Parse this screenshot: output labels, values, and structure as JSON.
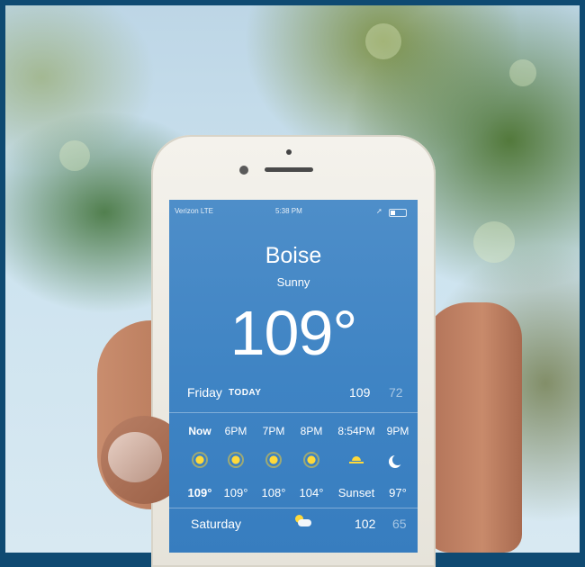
{
  "status_bar": {
    "carrier": "Verizon  LTE",
    "time": "5:38 PM"
  },
  "weather": {
    "city": "Boise",
    "condition": "Sunny",
    "current_temp": "109°",
    "today": {
      "day": "Friday",
      "tag": "TODAY",
      "high": "109",
      "low": "72"
    },
    "hourly": [
      {
        "label": "Now",
        "icon": "sun-icon",
        "temp": "109°"
      },
      {
        "label": "6PM",
        "icon": "sun-icon",
        "temp": "109°"
      },
      {
        "label": "7PM",
        "icon": "sun-icon",
        "temp": "108°"
      },
      {
        "label": "8PM",
        "icon": "sun-icon",
        "temp": "104°"
      },
      {
        "label": "8:54PM",
        "icon": "sunset-icon",
        "temp": "Sunset"
      },
      {
        "label": "9PM",
        "icon": "moon-icon",
        "temp": "97°"
      }
    ],
    "forecast": [
      {
        "day": "Saturday",
        "icon": "partly-cloudy-icon",
        "high": "102",
        "low": "65"
      }
    ]
  },
  "colors": {
    "screen_blue": "#3f84c4",
    "frame": "#0f4a72",
    "sun": "#ffd93a"
  }
}
